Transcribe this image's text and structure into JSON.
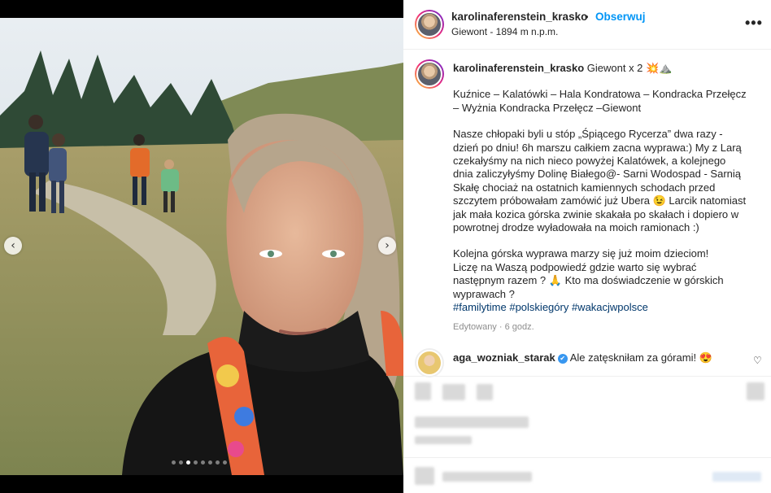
{
  "post": {
    "username": "karolinaferenstein_krasko",
    "separator": "•",
    "follow_label": "Obserwuj",
    "location": "Giewont - 1894 m n.p.m.",
    "more_label": "•••",
    "prev_label": "‹",
    "next_label": "›",
    "carousel_total": 8,
    "carousel_active": 3
  },
  "caption": {
    "username": "karolinaferenstein_krasko",
    "title": "Giewont x 2 💥⛰️",
    "route_lines": [
      "Kuźnice – Kalatówki – Hala Kondratowa – Kondracka Przełęcz",
      "– Wyżnia Kondracka Przełęcz –Giewont"
    ],
    "story_lines": [
      "Nasze chłopaki byli u stóp „Śpiącego Rycerza” dwa razy -",
      "dzień po dniu! 6h marszu całkiem zacna wyprawa:) My z Larą",
      "czekałyśmy na nich nieco powyżej Kalatówek, a kolejnego",
      "dnia zaliczyłyśmy Dolinę Białego@- Sarni Wodospad - Sarnią",
      "Skałę chociaż na ostatnich kamiennych schodach przed",
      "szczytem próbowałam zamówić już Ubera 😉 Larcik natomiast",
      "jak mała kozica górska zwinie skakała po skałach i dopiero w",
      "powrotnej drodze wyładowała na moich ramionach :)"
    ],
    "question_lines": [
      "Kolejna górska wyprawa marzy się już moim dzieciom!",
      "Liczę na Waszą podpowiedź gdzie warto się wybrać",
      "następnym razem ? 🙏 Kto ma doświadczenie w górskich",
      "wyprawach ?"
    ],
    "hashtags": "#familytime #polskiegóry #wakacjwpolsce",
    "meta": "Edytowany · 6 godz."
  },
  "comment": {
    "username": "aga_wozniak_starak",
    "verified_mark": "✔",
    "text": "Ale zatęskniłam za górami! 😍",
    "like_icon": "♡"
  },
  "icons": [
    "chevron-left-icon",
    "chevron-right-icon",
    "more-icon",
    "verified-icon",
    "heart-icon"
  ],
  "colors": {
    "follow": "#0095f6",
    "hashtag": "#00376b",
    "verified": "#3897f0",
    "muted": "#8e8e8e"
  }
}
